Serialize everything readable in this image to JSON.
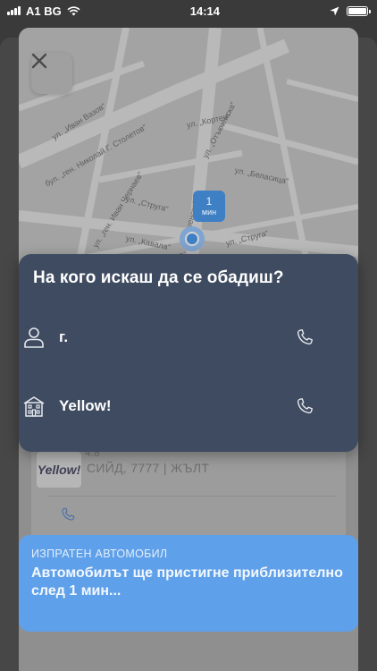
{
  "status_bar": {
    "carrier": "A1 BG",
    "time": "14:14",
    "icons": [
      "signal-icon",
      "wifi-icon",
      "location-arrow-icon",
      "battery-icon"
    ]
  },
  "map": {
    "streets": [
      "ул. „Иван Вазов“",
      "бул. „ген. Николай Г. Столетов“",
      "ул. „Кортен“",
      "ул. „Отъкченска“",
      "ул. „Беласица“",
      "ул. „ген. Иван Чернаев“",
      "ул. „Струга“",
      "ул. „Кавала“",
      "ул. „Струга“",
      "ул. „Отъкченска“"
    ],
    "eta": {
      "value": "1",
      "unit": "мин"
    }
  },
  "driver_card": {
    "logo_text": "Yellow!",
    "rating": "4.8",
    "car_info": "СИЙД, 7777 | ЖЪЛТ"
  },
  "dialog": {
    "title": "На кого искаш да се обадиш?",
    "options": [
      {
        "name": "г.",
        "icon": "person-icon"
      },
      {
        "name": "Yellow!",
        "icon": "building-icon"
      }
    ]
  },
  "banner": {
    "label": "ИЗПРАТЕН АВТОМОБИЛ",
    "message": "Автомобилът ще пристигне приблизително след 1 мин..."
  },
  "colors": {
    "dialog_bg": "#3f4b60",
    "accent_blue": "#3f7fc4",
    "banner_bg": "#5fa0ea"
  }
}
